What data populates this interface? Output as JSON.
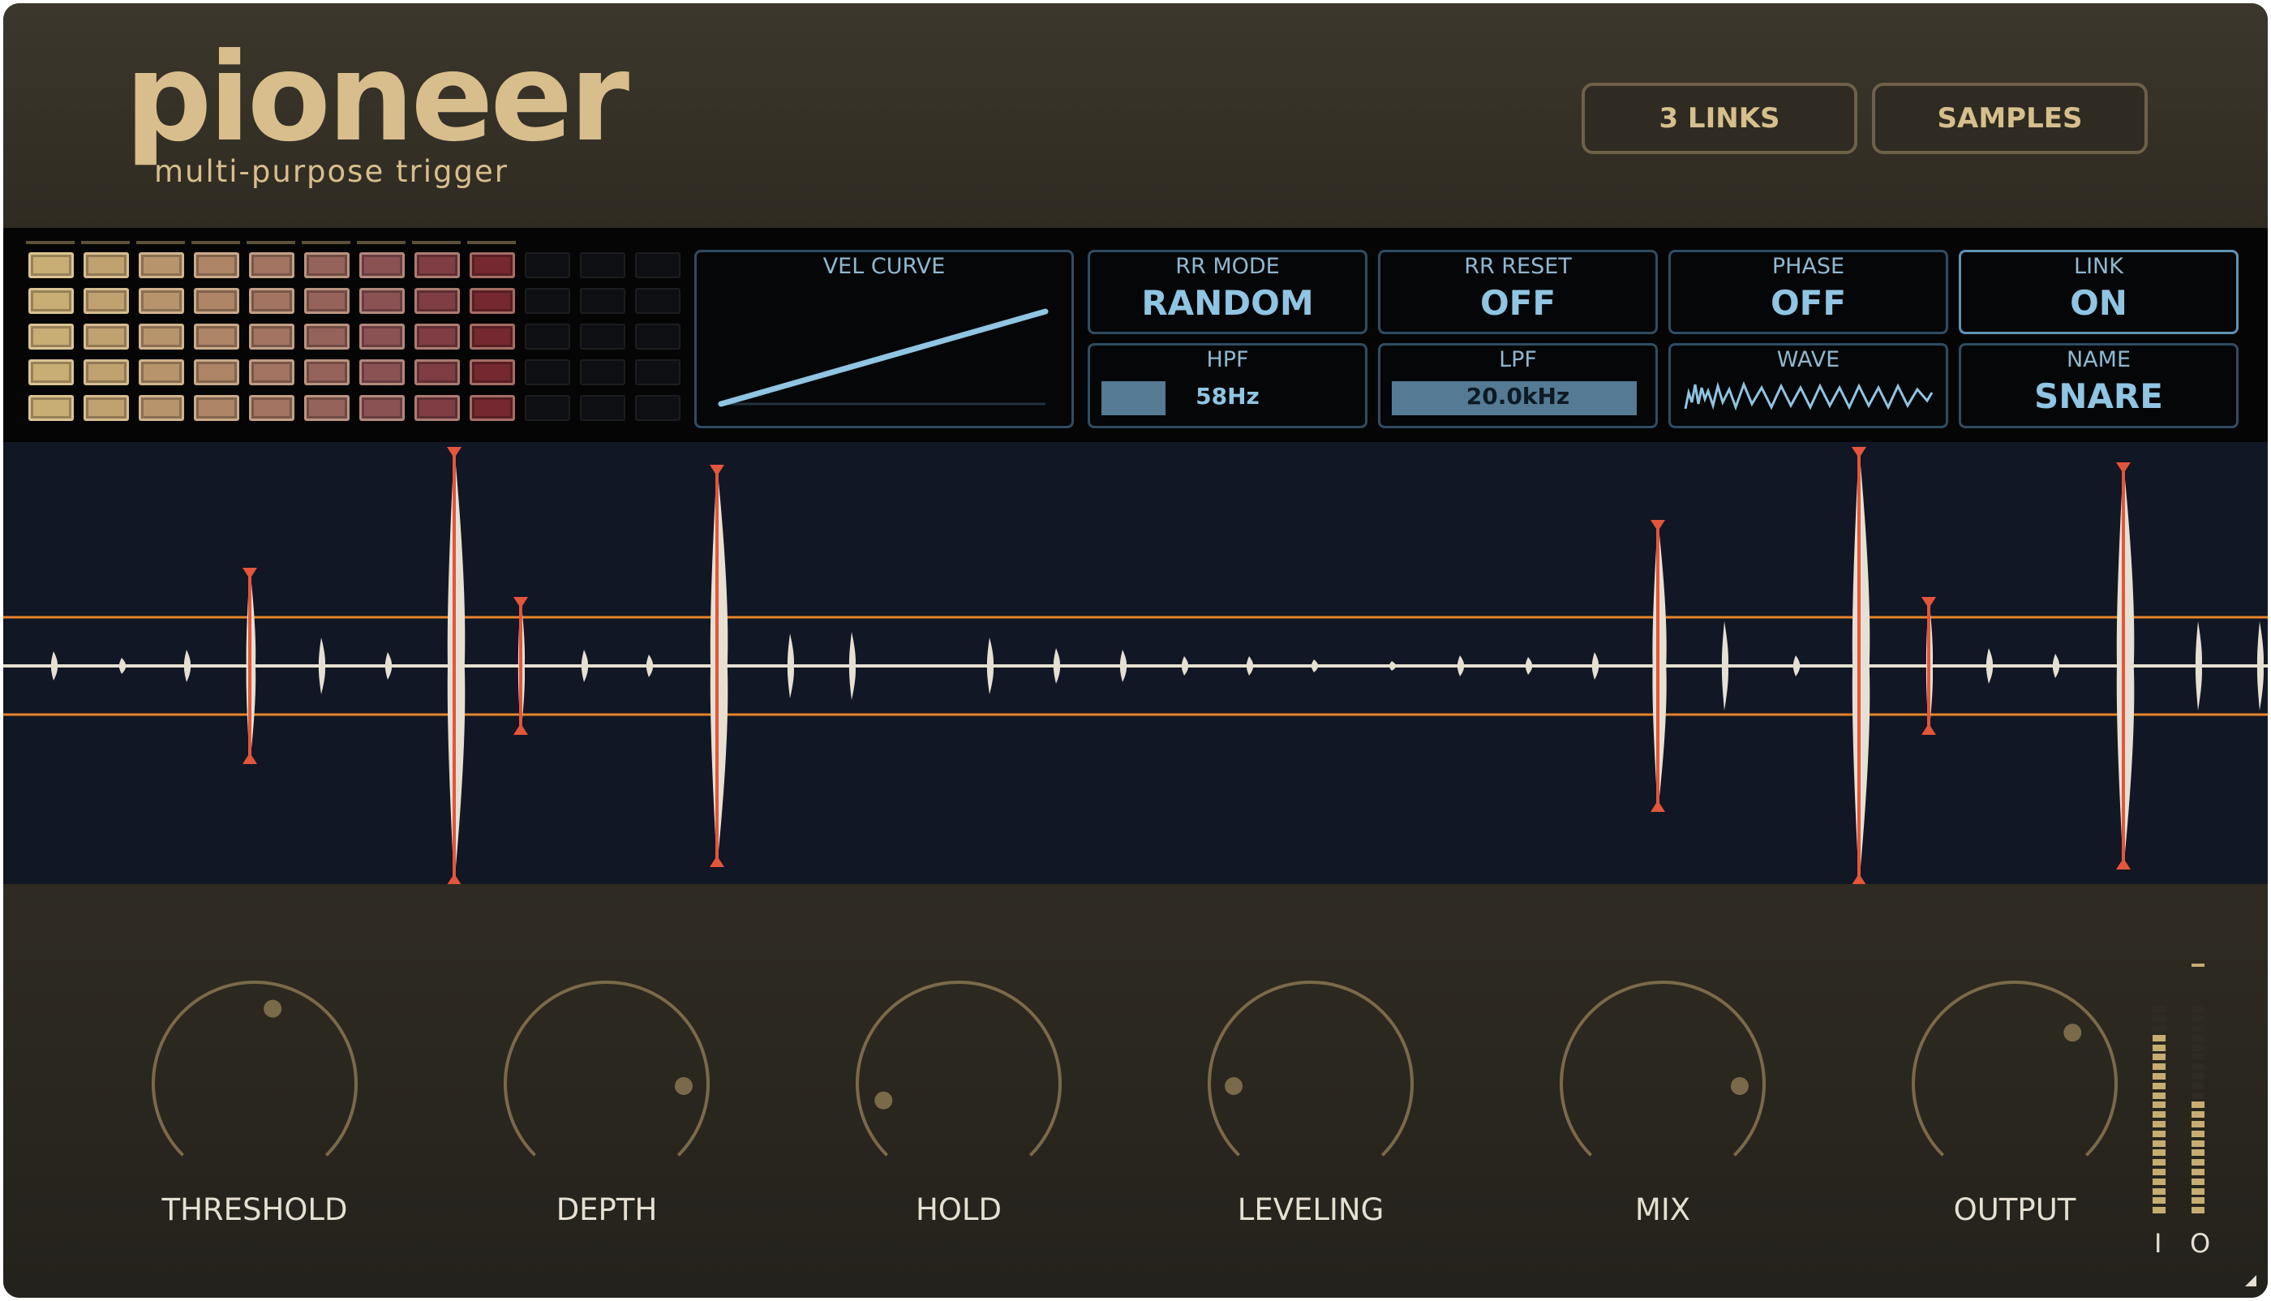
{
  "header": {
    "logo_word": "pioneer",
    "logo_tagline": "multi-purpose trigger",
    "links_button": "3 LINKS",
    "samples_button": "SAMPLES"
  },
  "pads": {
    "columns": 12,
    "rows": 5,
    "active_columns": 9,
    "colors": [
      "#c8ad75",
      "#c0a170",
      "#b8946c",
      "#ad8466",
      "#a27461",
      "#96635a",
      "#8b5254",
      "#7f3e43",
      "#75282f"
    ]
  },
  "panels": {
    "vel_curve": {
      "label": "VEL CURVE"
    },
    "rr_mode": {
      "label": "RR MODE",
      "value": "RANDOM"
    },
    "rr_reset": {
      "label": "RR RESET",
      "value": "OFF"
    },
    "phase": {
      "label": "PHASE",
      "value": "OFF"
    },
    "link": {
      "label": "LINK",
      "value": "ON"
    },
    "hpf": {
      "label": "HPF",
      "value": "58Hz",
      "fill": 0.25
    },
    "lpf": {
      "label": "LPF",
      "value": "20.0kHz",
      "fill": 0.96
    },
    "wave": {
      "label": "WAVE"
    },
    "name": {
      "label": "NAME",
      "value": "SNARE"
    }
  },
  "knobs": [
    {
      "label": "THRESHOLD",
      "value": 0.55
    },
    {
      "label": "DEPTH",
      "value": 0.84
    },
    {
      "label": "HOLD",
      "value": 0.12
    },
    {
      "label": "LEVELING",
      "value": 0.16
    },
    {
      "label": "MIX",
      "value": 0.84
    },
    {
      "label": "OUTPUT",
      "value": 0.68
    }
  ],
  "meters": {
    "in_label": "I",
    "out_label": "O",
    "in_level": 0.85,
    "out_level": 0.55
  },
  "colors": {
    "accent": "#d8be8c",
    "panel_text": "#8fc5e2",
    "trigger": "#e4553a",
    "threshold_line": "#e8832b"
  }
}
